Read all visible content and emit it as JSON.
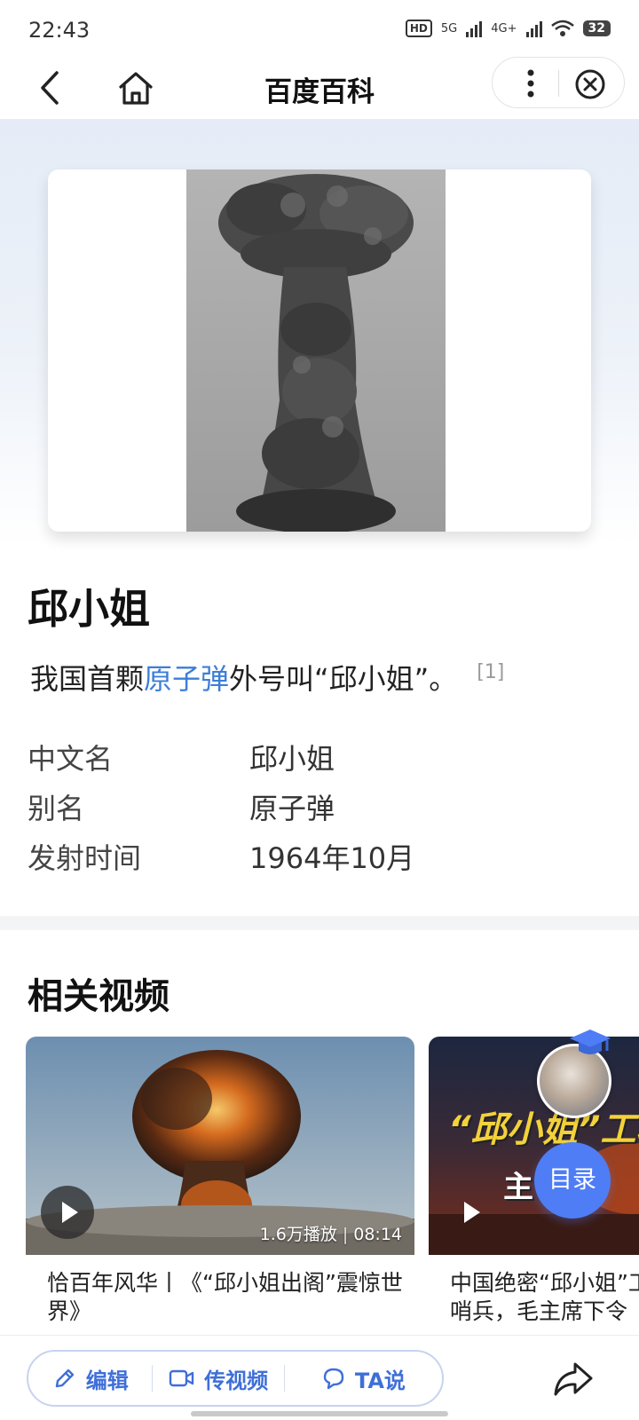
{
  "status_bar": {
    "time": "22:43",
    "hd": "HD",
    "net1": "5G",
    "net2": "4G+",
    "battery": "32"
  },
  "nav": {
    "title": "百度百科",
    "icons": [
      "back-icon",
      "home-icon",
      "more-icon",
      "close-icon"
    ]
  },
  "entry": {
    "title": "邱小姐",
    "summary_prefix": "我国首颗",
    "summary_link": "原子弹",
    "summary_suffix": "外号叫“邱小姐”。",
    "ref": "[1]",
    "info": [
      {
        "key": "中文名",
        "value": "邱小姐"
      },
      {
        "key": "别名",
        "value": "原子弹"
      },
      {
        "key": "发射时间",
        "value": "1964年10月"
      }
    ]
  },
  "related_videos": {
    "title": "相关视频",
    "items": [
      {
        "title": "恰百年风华丨《“邱小姐出阁”震惊世界》",
        "plays": "1.6万播放",
        "duration": "08:14"
      },
      {
        "title": "中国绝密“邱小姐”工程",
        "line2": "哨兵，毛主席下令",
        "thumb_text": "“邱小姐”工程",
        "thumb_sub": "主 最"
      }
    ]
  },
  "floating": {
    "toc_label": "目录"
  },
  "bottom_bar": {
    "edit": "编辑",
    "upload_video": "传视频",
    "ta_say": "TA说",
    "icons": [
      "edit-icon",
      "video-icon",
      "chat-icon",
      "share-icon"
    ]
  },
  "colors": {
    "link": "#3d7ed8",
    "accent": "#4f7df5",
    "bottom_text": "#3f6fd8"
  }
}
